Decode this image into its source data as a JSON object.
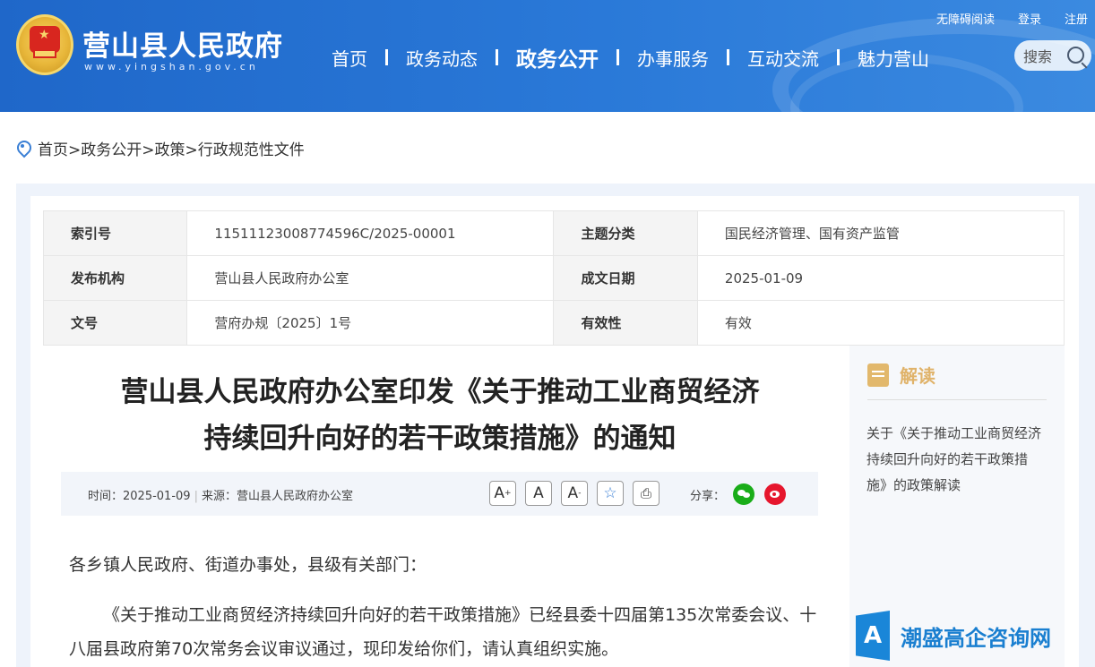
{
  "header": {
    "site_title": "营山县人民政府",
    "site_domain": "www.yingshan.gov.cn",
    "nav": [
      "首页",
      "政务动态",
      "政务公开",
      "办事服务",
      "互动交流",
      "魅力营山"
    ],
    "nav_active_index": 2,
    "top_links": [
      "无障碍阅读",
      "登录",
      "注册"
    ],
    "search_label": "搜索",
    "colors": {
      "primary": "#2a79d8"
    }
  },
  "breadcrumb": "首页>政务公开>政策>行政规范性文件",
  "meta": {
    "rows": [
      {
        "k1": "索引号",
        "v1": "11511123008774596C/2025-00001",
        "k2": "主题分类",
        "v2": "国民经济管理、国有资产监管"
      },
      {
        "k1": "发布机构",
        "v1": "营山县人民政府办公室",
        "k2": "成文日期",
        "v2": "2025-01-09"
      },
      {
        "k1": "文号",
        "v1": "营府办规〔2025〕1号",
        "k2": "有效性",
        "v2": "有效"
      }
    ]
  },
  "article": {
    "title_line1": "营山县人民政府办公室印发《关于推动工业商贸经济",
    "title_line2": "持续回升向好的若干政策措施》的通知",
    "time_label": "时间：2025-01-09",
    "source_label": "来源：营山县人民政府办公室",
    "share_label": "分享：",
    "paragraph1": "各乡镇人民政府、街道办事处，县级有关部门：",
    "paragraph2": "《关于推动工业商贸经济持续回升向好的若干政策措施》已经县委十四届第135次常委会议、十八届县政府第70次常务会议审议通过，现印发给你们，请认真组织实施。"
  },
  "side": {
    "heading": "解读",
    "link": "关于《关于推动工业商贸经济持续回升向好的若干政策措施》的政策解读"
  },
  "watermark": {
    "logo_letter": "A",
    "text": "潮盛高企咨询网"
  }
}
